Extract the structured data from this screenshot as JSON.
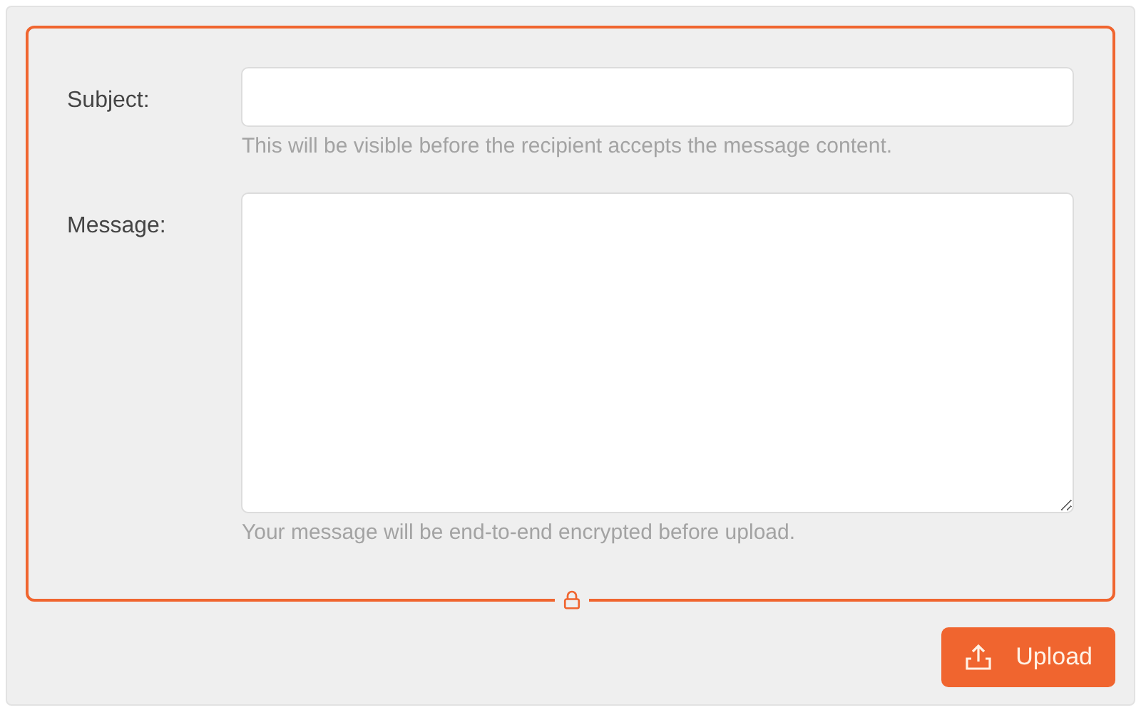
{
  "fields": [
    {
      "kind": "input",
      "label": "Subject:",
      "hint": "This will be visible before the recipient accepts the message content."
    },
    {
      "kind": "textarea",
      "label": "Message:",
      "hint": "Your message will be end-to-end encrypted before upload."
    }
  ],
  "upload_button": {
    "label": "Upload"
  }
}
